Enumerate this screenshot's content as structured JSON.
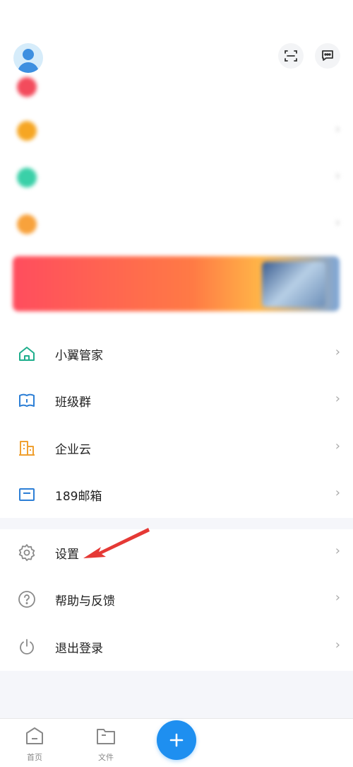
{
  "colors": {
    "accent": "#1e8ff0",
    "arrow": "#e53935",
    "home_icon": "#1fae8c",
    "class_icon": "#2d7fd6",
    "enterprise_icon": "#f0a030",
    "mail_icon": "#2d7fd6",
    "gray_icon": "#8a8a8a"
  },
  "header": {
    "avatar": "user-avatar",
    "scan_icon": "scan-icon",
    "message_icon": "message-icon"
  },
  "blurred_items": [
    {
      "dot_color": "#f34b5c",
      "label": "",
      "chevron": "›"
    },
    {
      "dot_color": "#f6a623",
      "label": "",
      "chevron": "›"
    },
    {
      "dot_color": "#3ad0a8",
      "label": "",
      "chevron": "›"
    },
    {
      "dot_color": "#f8a23c",
      "label": "",
      "chevron": "›"
    }
  ],
  "banner": {
    "text": ""
  },
  "menu": [
    {
      "label": "小翼管家",
      "icon": "home-icon",
      "chevron": "›"
    },
    {
      "label": "班级群",
      "icon": "book-icon",
      "chevron": "›"
    },
    {
      "label": "企业云",
      "icon": "building-icon",
      "chevron": "›"
    },
    {
      "label": "189邮箱",
      "icon": "mail-icon",
      "chevron": "›"
    }
  ],
  "menu2": [
    {
      "label": "设置",
      "icon": "gear-icon",
      "chevron": "›"
    },
    {
      "label": "帮助与反馈",
      "icon": "help-icon",
      "chevron": "›"
    },
    {
      "label": "退出登录",
      "icon": "power-icon",
      "chevron": "›"
    }
  ],
  "tabbar": {
    "home": {
      "label": "首页",
      "icon": "home-tab-icon"
    },
    "files": {
      "label": "文件",
      "icon": "folder-icon"
    },
    "add": {
      "label": "+",
      "icon": "plus-icon"
    }
  }
}
